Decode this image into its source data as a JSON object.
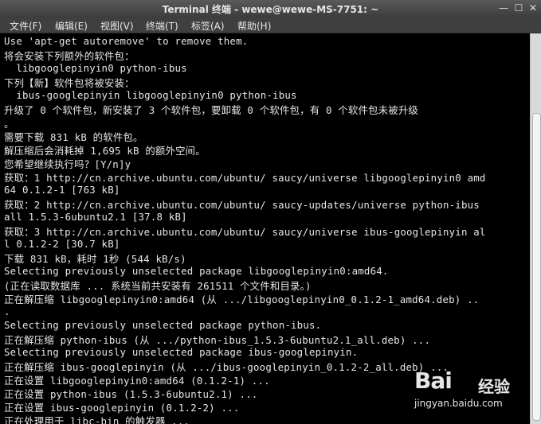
{
  "window": {
    "title": "Terminal 终端 - wewe@wewe-MS-7751: ~",
    "buttons": {
      "minimize": "—",
      "maximize": "☐",
      "close": "✕"
    }
  },
  "menu": {
    "items": [
      "文件(F)",
      "编辑(E)",
      "视图(V)",
      "终端(T)",
      "标签(A)",
      "帮助(H)"
    ]
  },
  "terminal": {
    "lines": [
      "Use 'apt-get autoremove' to remove them.",
      "将会安装下列额外的软件包：",
      "  libgooglepinyin0 python-ibus",
      "下列【新】软件包将被安装：",
      "  ibus-googlepinyin libgooglepinyin0 python-ibus",
      "升级了 0 个软件包，新安装了 3 个软件包，要卸载 0 个软件包，有 0 个软件包未被升级",
      "。",
      "需要下载 831 kB 的软件包。",
      "解压缩后会消耗掉 1,695 kB 的额外空间。",
      "您希望继续执行吗？[Y/n]y",
      "获取：1 http://cn.archive.ubuntu.com/ubuntu/ saucy/universe libgooglepinyin0 amd",
      "64 0.1.2-1 [763 kB]",
      "获取：2 http://cn.archive.ubuntu.com/ubuntu/ saucy-updates/universe python-ibus",
      "all 1.5.3-6ubuntu2.1 [37.8 kB]",
      "获取：3 http://cn.archive.ubuntu.com/ubuntu/ saucy/universe ibus-googlepinyin al",
      "l 0.1.2-2 [30.7 kB]",
      "下载 831 kB，耗时 1秒 (544 kB/s)",
      "Selecting previously unselected package libgooglepinyin0:amd64.",
      "(正在读取数据库 ... 系统当前共安装有 261511 个文件和目录。)",
      "正在解压缩 libgooglepinyin0:amd64 (从 .../libgooglepinyin0_0.1.2-1_amd64.deb) ..",
      ".",
      "Selecting previously unselected package python-ibus.",
      "正在解压缩 python-ibus (从 .../python-ibus_1.5.3-6ubuntu2.1_all.deb) ...",
      "Selecting previously unselected package ibus-googlepinyin.",
      "正在解压缩 ibus-googlepinyin (从 .../ibus-googlepinyin_0.1.2-2_all.deb) ...",
      "正在设置 libgooglepinyin0:amd64 (0.1.2-1) ...",
      "正在设置 python-ibus (1.5.3-6ubuntu2.1) ...",
      "正在设置 ibus-googlepinyin (0.1.2-2) ...",
      "正在处理用于 libc-bin 的触发器 ..."
    ]
  },
  "watermark": {
    "logo": "Bai",
    "logo_suffix": "经验",
    "url": "jingyan.baidu.com"
  }
}
